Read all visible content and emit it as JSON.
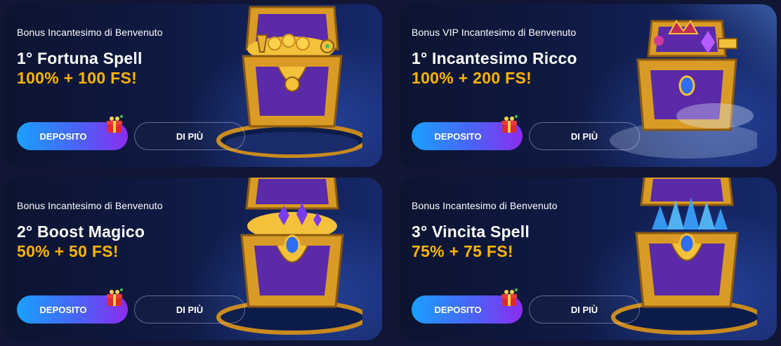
{
  "cards": [
    {
      "subtitle": "Bonus Incantesimo di Benvenuto",
      "title": "1° Fortuna Spell",
      "offer": "100% + 100 FS!",
      "deposit_label": "DEPOSITO",
      "more_label": "DI PIÙ",
      "chest_contents": "gold-coins"
    },
    {
      "subtitle": "Bonus VIP Incantesimo di Benvenuto",
      "title": "1° Incantesimo Ricco",
      "offer": "100% + 200 FS!",
      "deposit_label": "DEPOSITO",
      "more_label": "DI PIÙ",
      "chest_contents": "crown-and-gems"
    },
    {
      "subtitle": "Bonus Incantesimo di Benvenuto",
      "title": "2° Boost Magico",
      "offer": "50% + 50 FS!",
      "deposit_label": "DEPOSITO",
      "more_label": "DI PIÙ",
      "chest_contents": "purple-gems"
    },
    {
      "subtitle": "Bonus Incantesimo di Benvenuto",
      "title": "3° Vincita Spell",
      "offer": "75% + 75 FS!",
      "deposit_label": "DEPOSITO",
      "more_label": "DI PIÙ",
      "chest_contents": "blue-crystals"
    }
  ],
  "colors": {
    "background": "#101633",
    "offer_text": "#ffb300",
    "deposit_gradient_start": "#1aa0ff",
    "deposit_gradient_end": "#8b2df0",
    "chest_gold": "#e8a82a",
    "chest_purple": "#5a2aa8"
  },
  "icons": {
    "gift": "gift-icon",
    "chest": "treasure-chest-illustration"
  }
}
